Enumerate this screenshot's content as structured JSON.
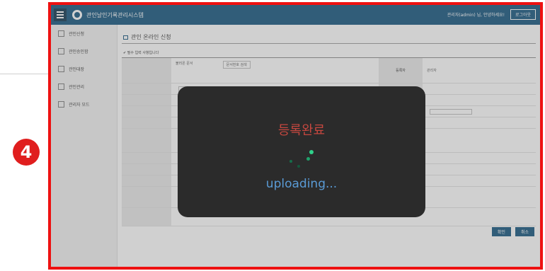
{
  "step_badge": "4",
  "app": {
    "title": "관인날인기록관리시스템",
    "user_info": "관리자(admin) 님, 안녕하세요!",
    "logout_label": "로그아웃"
  },
  "nav": {
    "items": [
      {
        "label": "관인신청"
      },
      {
        "label": "관인승인함"
      },
      {
        "label": "관인대장"
      },
      {
        "label": "관인관리"
      },
      {
        "label": "관리자 모드"
      }
    ]
  },
  "page": {
    "title": "관인 온라인 신청",
    "required_note": "✔ 필수 입력 사항입니다"
  },
  "form": {
    "selected_doc": "불러온 문서",
    "doc_search_label": "문서번호 검색",
    "registrant_label": "등록자",
    "registrant_value": "관리자"
  },
  "buttons": {
    "confirm_label": "확인",
    "cancel_label": "취소"
  },
  "modal": {
    "title": "등록완료",
    "status": "uploading..."
  },
  "colors": {
    "frame": "#ee1111",
    "topbar": "#0b4f7a",
    "modal_bg": "#2b2b2b",
    "modal_title": "#c5473f",
    "modal_status": "#5a9bd6",
    "spinner": "#1ea26b"
  }
}
